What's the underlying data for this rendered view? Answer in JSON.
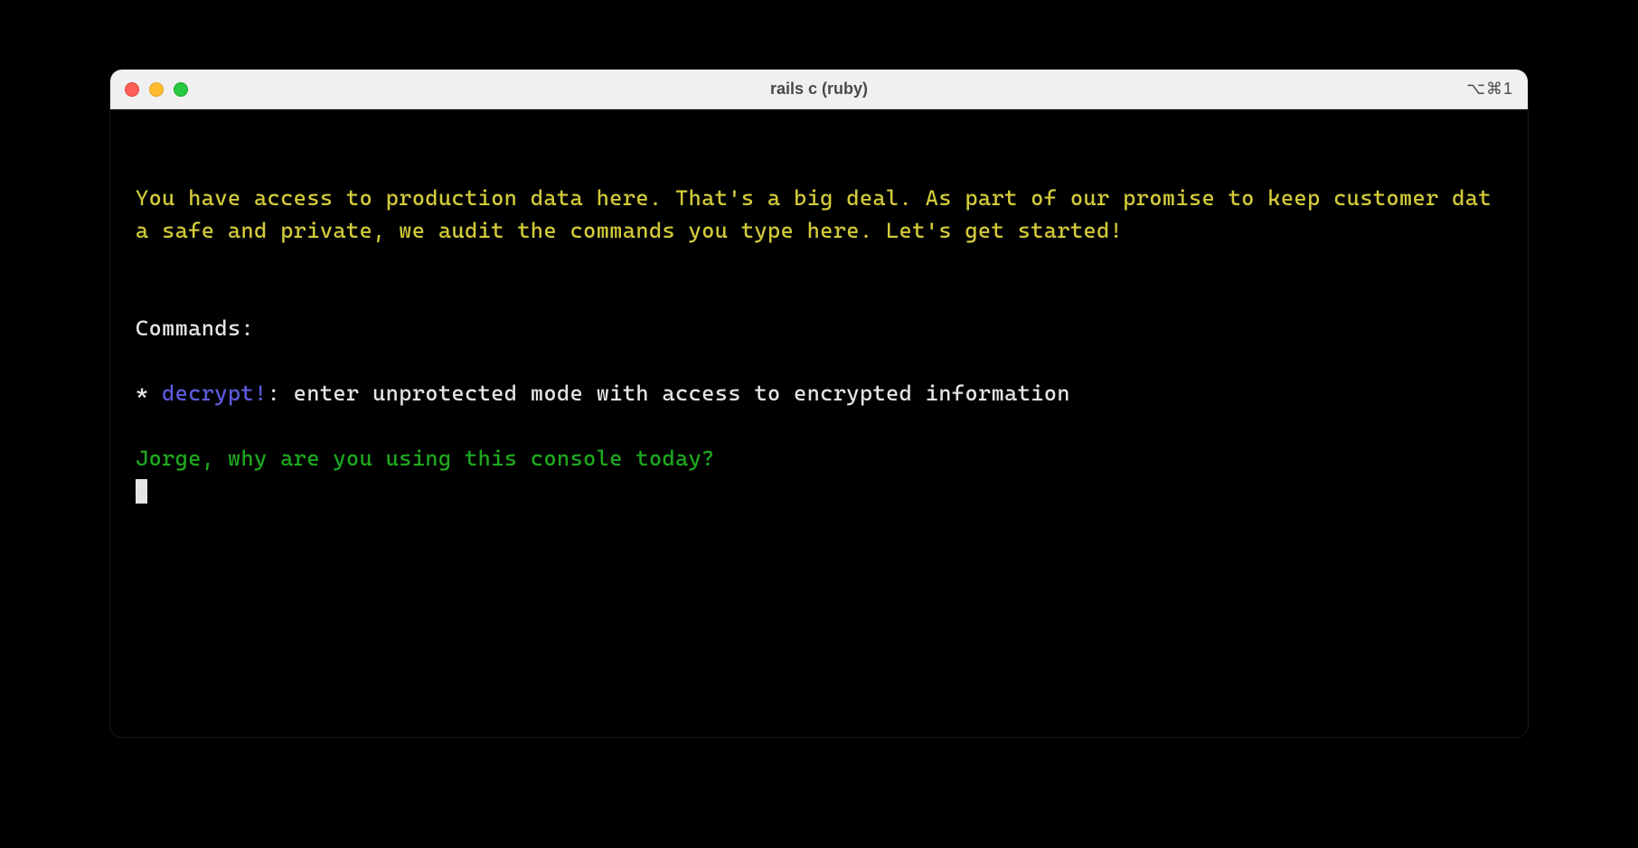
{
  "window": {
    "title": "rails c (ruby)",
    "shortcut": "⌥⌘1"
  },
  "terminal": {
    "warning": "You have access to production data here. That's a big deal. As part of our promise to keep customer data safe and private, we audit the commands you type here. Let's get started!",
    "commands_label": "Commands:",
    "bullet": "* ",
    "command_name": "decrypt!",
    "command_desc": ": enter unprotected mode with access to encrypted information",
    "prompt": "Jorge, why are you using this console today?"
  }
}
